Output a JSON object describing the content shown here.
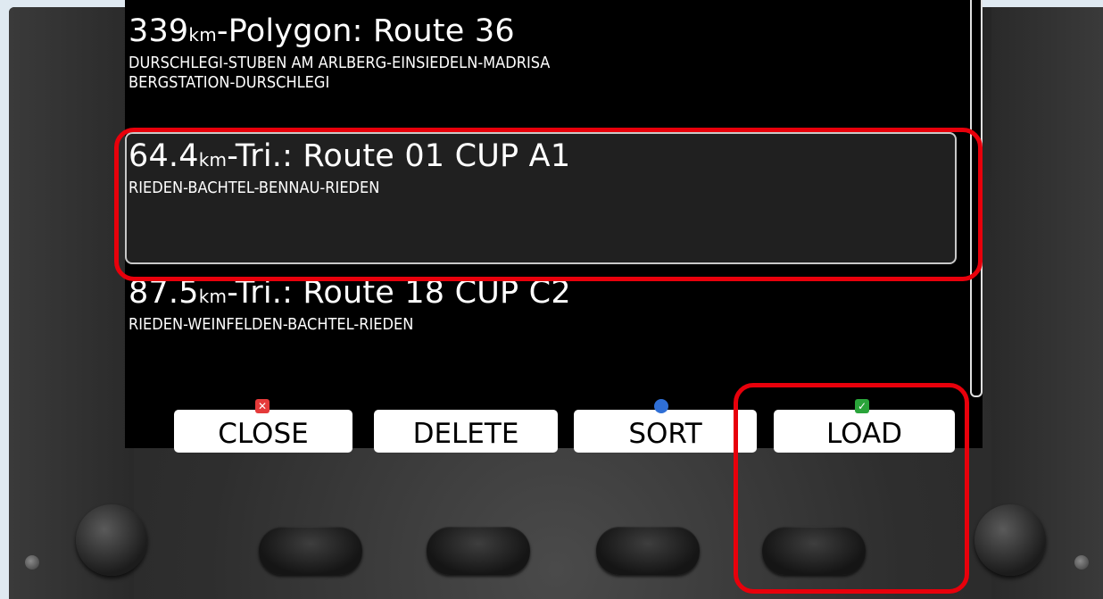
{
  "routes": [
    {
      "distance": "339",
      "unit": "km",
      "rest": "-Polygon: Route 36",
      "description_line1": "DURSCHLEGI-STUBEN AM ARLBERG-EINSIEDELN-MADRISA",
      "description_line2": "BERGSTATION-DURSCHLEGI"
    },
    {
      "distance": "64.4",
      "unit": "km",
      "rest": "-Tri.: Route 01 CUP A1",
      "description_line1": "RIEDEN-BACHTEL-BENNAU-RIEDEN",
      "selected": true
    },
    {
      "distance": "87.5",
      "unit": "km",
      "rest": "-Tri.: Route 18 CUP C2",
      "description_line1": "RIEDEN-WEINFELDEN-BACHTEL-RIEDEN"
    }
  ],
  "softkeys": {
    "close": {
      "label": "CLOSE",
      "icon": "close-x-icon",
      "color": "#e53a3a"
    },
    "delete": {
      "label": "DELETE"
    },
    "sort": {
      "label": "SORT",
      "icon": "sort-dot-icon",
      "color": "#2f6fd6"
    },
    "load": {
      "label": "LOAD",
      "icon": "check-icon",
      "color": "#2aa43a"
    }
  },
  "icons": {
    "close": "✕",
    "sort": "●",
    "load": "✓"
  },
  "annotation_color": "#e8000b"
}
